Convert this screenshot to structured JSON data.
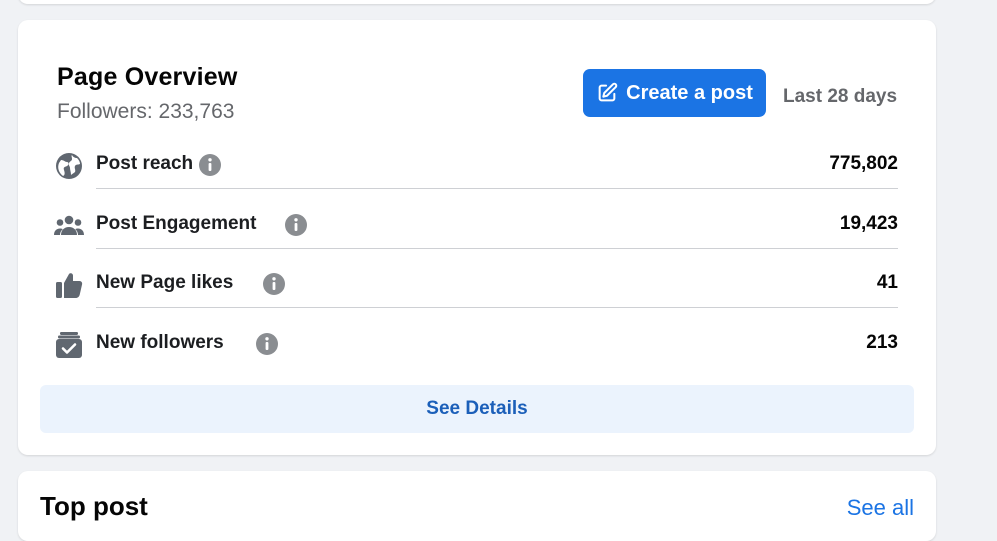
{
  "overview": {
    "title": "Page Overview",
    "followers": "Followers: 233,763",
    "create_post_label": "Create a post",
    "range": "Last 28 days",
    "metrics": [
      {
        "label": "Post reach",
        "value": "775,802",
        "icon": "globe-icon"
      },
      {
        "label": "Post Engagement",
        "value": "19,423",
        "icon": "people-icon"
      },
      {
        "label": "New Page likes",
        "value": "41",
        "icon": "thumbs-up-icon"
      },
      {
        "label": "New followers",
        "value": "213",
        "icon": "follow-check-icon"
      }
    ],
    "see_details_label": "See Details"
  },
  "top_post": {
    "title": "Top post",
    "see_all_label": "See all"
  },
  "colors": {
    "accent": "#1b74e4",
    "secondary_text": "#65676b",
    "link_blue": "#1b5fb9",
    "details_bg": "#ebf3fd"
  }
}
